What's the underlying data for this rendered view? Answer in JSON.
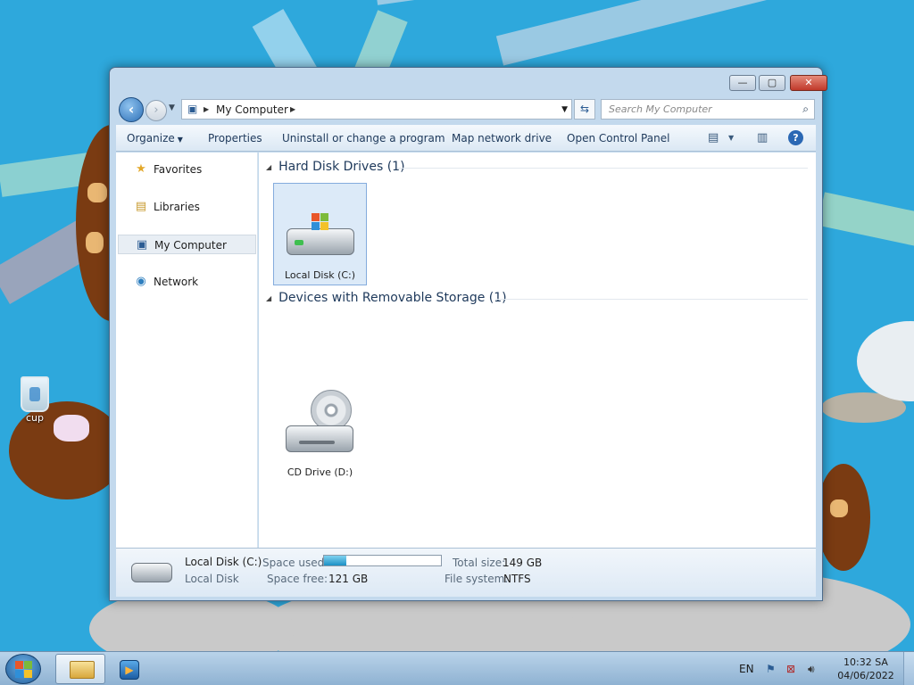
{
  "desktop": {
    "icons": [
      {
        "label": "cup",
        "icon": "recycle-bin-icon"
      }
    ]
  },
  "window": {
    "title_buttons": {
      "minimize": "—",
      "maximize": "▢",
      "close": "✕"
    },
    "address": {
      "path": "My Computer"
    },
    "search": {
      "placeholder": "Search My Computer"
    },
    "toolbar": {
      "organize": "Organize",
      "properties": "Properties",
      "uninstall": "Uninstall or change a program",
      "map_drive": "Map network drive",
      "control_panel": "Open Control Panel",
      "help": "?"
    },
    "nav": {
      "items": [
        {
          "label": "Favorites",
          "icon": "star-icon",
          "glyph": "★",
          "selected": false
        },
        {
          "label": "Libraries",
          "icon": "libraries-icon",
          "glyph": "▤",
          "selected": false
        },
        {
          "label": "My Computer",
          "icon": "computer-icon",
          "glyph": "▣",
          "selected": true
        },
        {
          "label": "Network",
          "icon": "network-icon",
          "glyph": "◉",
          "selected": false
        }
      ]
    },
    "groups": [
      {
        "title": "Hard Disk Drives (1)",
        "items": [
          {
            "label": "Local Disk (C:)",
            "icon": "hard-drive-icon",
            "selected": true
          }
        ]
      },
      {
        "title": "Devices with Removable Storage (1)",
        "items": [
          {
            "label": "CD Drive (D:)",
            "icon": "cd-drive-icon",
            "selected": false
          }
        ]
      }
    ],
    "details": {
      "name": "Local Disk (C:)",
      "type": "Local Disk",
      "space_used_label": "Space used:",
      "space_free_label": "Space free:",
      "space_free": "121 GB",
      "total_size_label": "Total size:",
      "total_size": "149 GB",
      "file_system_label": "File system:",
      "file_system": "NTFS",
      "used_fraction": 0.19
    }
  },
  "taskbar": {
    "language": "EN",
    "time": "10:32 SA",
    "date": "04/06/2022"
  },
  "colors": {
    "desktop": "#2ea8dc",
    "accent": "#1e395b",
    "selection": "#dceaf8"
  }
}
